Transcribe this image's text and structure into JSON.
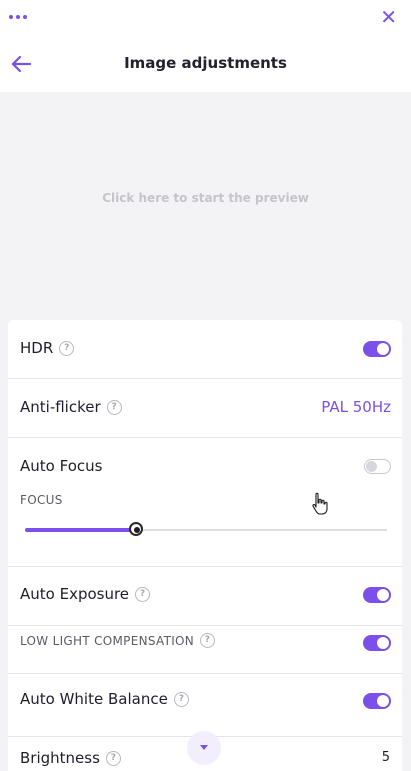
{
  "window": {
    "menu_icon": "more-dots-icon",
    "close_icon": "close-icon"
  },
  "header": {
    "title": "Image adjustments",
    "back_icon": "back-arrow-icon"
  },
  "preview": {
    "prompt": "Click here to start the preview"
  },
  "settings": {
    "hdr": {
      "label": "HDR",
      "enabled": true
    },
    "anti_flicker": {
      "label": "Anti-flicker",
      "value": "PAL 50Hz"
    },
    "auto_focus": {
      "label": "Auto Focus",
      "enabled": false
    },
    "focus": {
      "label": "FOCUS",
      "level_fraction": 0.31
    },
    "auto_exposure": {
      "label": "Auto Exposure",
      "enabled": true
    },
    "low_light": {
      "label": "LOW LIGHT COMPENSATION",
      "enabled": true
    },
    "auto_white_balance": {
      "label": "Auto White Balance",
      "enabled": true
    },
    "brightness": {
      "label": "Brightness",
      "value": "5"
    }
  },
  "help_glyph": "?",
  "colors": {
    "accent": "#7b4fe9",
    "background": "#f3f3f5"
  }
}
